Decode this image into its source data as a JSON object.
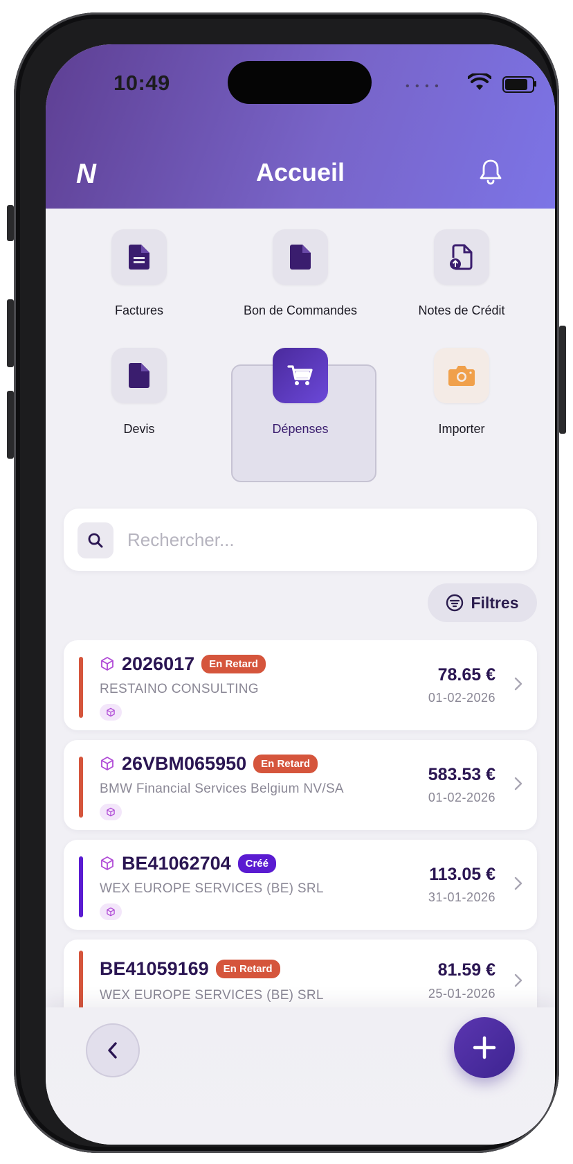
{
  "status_bar": {
    "time": "10:49"
  },
  "header": {
    "logo": "N",
    "title": "Accueil"
  },
  "menu": [
    {
      "label": "Factures",
      "icon": "document-lines-icon"
    },
    {
      "label": "Bon de Commandes",
      "icon": "document-icon"
    },
    {
      "label": "Notes de Crédit",
      "icon": "document-upload-icon"
    },
    {
      "label": "Devis",
      "icon": "document-icon"
    },
    {
      "label": "Dépenses",
      "icon": "cart-icon",
      "selected": true
    },
    {
      "label": "Importer",
      "icon": "camera-icon"
    }
  ],
  "search": {
    "placeholder": "Rechercher..."
  },
  "filters": {
    "label": "Filtres"
  },
  "expenses": [
    {
      "ref": "2026017",
      "status": "En Retard",
      "company": "RESTAINO CONSULTING",
      "amount": "78.65 €",
      "date": "01-02-2026"
    },
    {
      "ref": "26VBM065950",
      "status": "En Retard",
      "company": "BMW Financial Services Belgium NV/SA",
      "amount": "583.53 €",
      "date": "01-02-2026"
    },
    {
      "ref": "BE41062704",
      "status": "Créé",
      "company": "WEX EUROPE SERVICES (BE) SRL",
      "amount": "113.05 €",
      "date": "31-01-2026"
    },
    {
      "ref": "BE41059169",
      "status": "En Retard",
      "company": "WEX EUROPE SERVICES (BE) SRL",
      "amount": "81.59 €",
      "date": "25-01-2026"
    }
  ],
  "colors": {
    "late": "#d5553c",
    "created": "#5a1bd1",
    "primary": "#3d2491",
    "camera": "#f0a04b"
  }
}
